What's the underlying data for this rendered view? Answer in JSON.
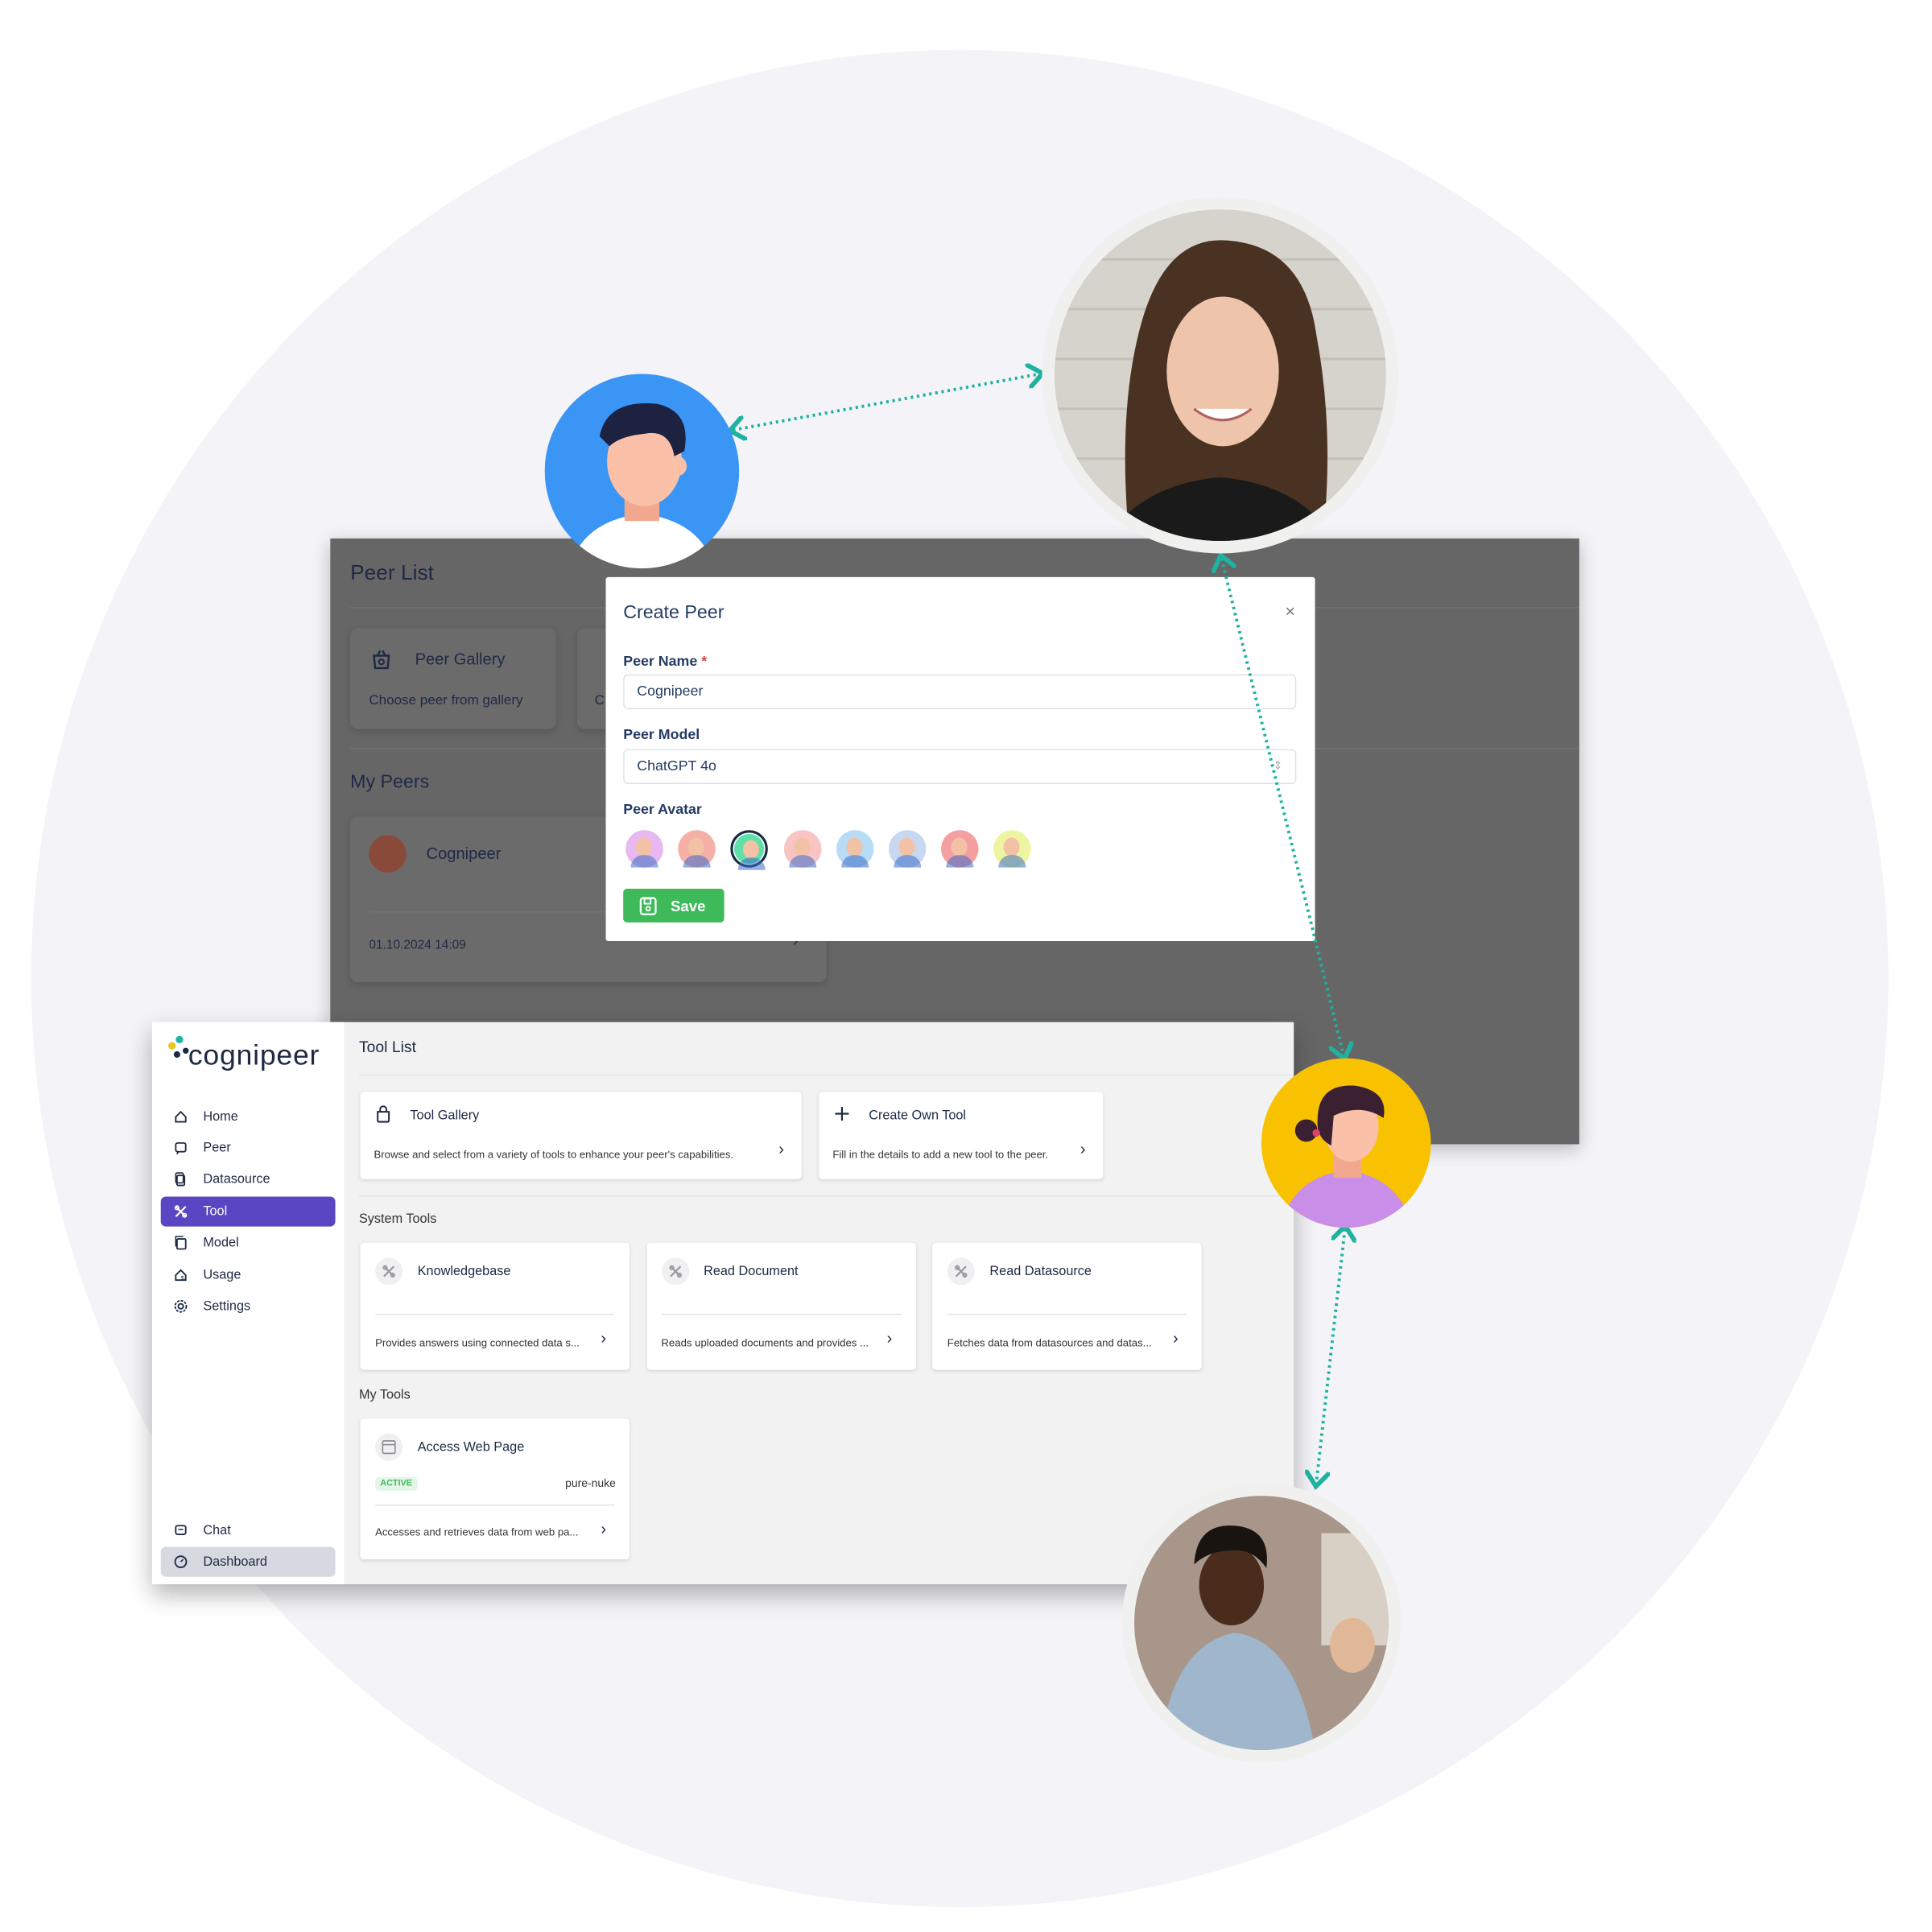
{
  "colors": {
    "accent": "#5a45c2",
    "save": "#3fba5a",
    "connector": "#20b2a0",
    "overlay": "#666666"
  },
  "peer_list": {
    "title": "Peer List",
    "gallery_card": {
      "title": "Peer Gallery",
      "description": "Choose peer from gallery",
      "icon": "basket-icon"
    },
    "partial_card_letter": "C",
    "my_peers_title": "My Peers",
    "peer_card": {
      "name": "Cognipeer",
      "date": "01.10.2024 14:09"
    }
  },
  "modal": {
    "title": "Create Peer",
    "close": "×",
    "name_label": "Peer Name",
    "required_mark": "*",
    "name_value": "Cognipeer",
    "model_label": "Peer Model",
    "model_value": "ChatGPT 4o",
    "avatar_label": "Peer Avatar",
    "avatars": [
      {
        "color": "#e8b8f0",
        "selected": false
      },
      {
        "color": "#f5b0a8",
        "selected": false
      },
      {
        "color": "#5fe0a8",
        "selected": true
      },
      {
        "color": "#f9c4c4",
        "selected": false
      },
      {
        "color": "#b8dcf5",
        "selected": false
      },
      {
        "color": "#c8d8f0",
        "selected": false
      },
      {
        "color": "#f5a0a0",
        "selected": false
      },
      {
        "color": "#eef5a0",
        "selected": false
      }
    ],
    "save_label": "Save"
  },
  "app": {
    "logo": "cognipeer",
    "nav": [
      {
        "label": "Home",
        "icon": "home-icon"
      },
      {
        "label": "Peer",
        "icon": "peer-icon"
      },
      {
        "label": "Datasource",
        "icon": "datasource-icon"
      },
      {
        "label": "Tool",
        "icon": "tool-icon",
        "active": true
      },
      {
        "label": "Model",
        "icon": "model-icon"
      },
      {
        "label": "Usage",
        "icon": "usage-icon"
      },
      {
        "label": "Settings",
        "icon": "gear-icon"
      }
    ],
    "bottom_nav": [
      {
        "label": "Chat",
        "icon": "chat-icon"
      },
      {
        "label": "Dashboard",
        "icon": "dashboard-icon"
      }
    ],
    "page_title": "Tool List",
    "top_cards": [
      {
        "title": "Tool Gallery",
        "description": "Browse and select from a variety of tools to enhance your peer's capabilities.",
        "icon": "bag-icon"
      },
      {
        "title": "Create Own Tool",
        "description": "Fill in the details to add a new tool to the peer.",
        "icon": "plus-icon"
      }
    ],
    "system_tools_title": "System Tools",
    "system_tools": [
      {
        "title": "Knowledgebase",
        "description": "Provides answers using connected data s..."
      },
      {
        "title": "Read Document",
        "description": "Reads uploaded documents and provides ..."
      },
      {
        "title": "Read Datasource",
        "description": "Fetches data from datasources and datas..."
      }
    ],
    "my_tools_title": "My Tools",
    "my_tools": [
      {
        "title": "Access Web Page",
        "status": "ACTIVE",
        "owner": "pure-nuke",
        "description": "Accesses and retrieves data from web pa..."
      }
    ]
  }
}
